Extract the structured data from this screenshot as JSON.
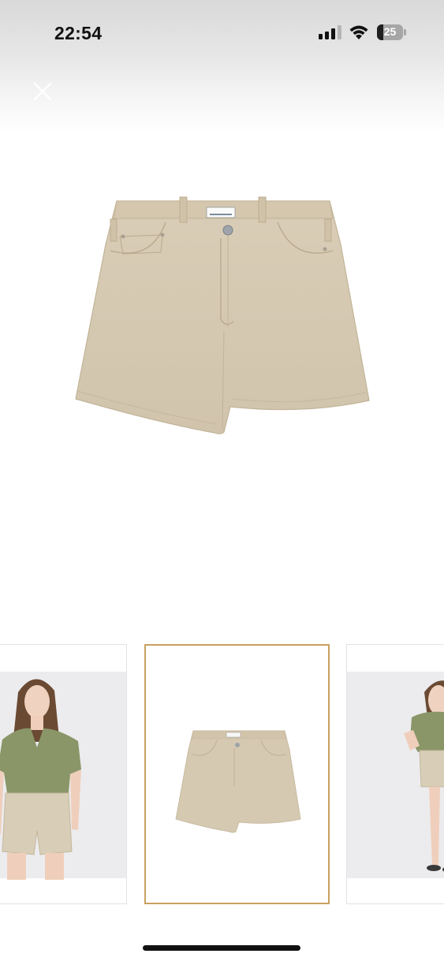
{
  "status_bar": {
    "time": "22:54",
    "battery_level": "25",
    "icons": [
      "cellular-signal-icon",
      "wifi-icon",
      "battery-icon"
    ]
  },
  "viewer": {
    "close_icon": "close-icon",
    "main_image": "beige-denim-shorts-product-photo",
    "thumbnails": [
      {
        "id": "model-front-green-tee",
        "selected": false
      },
      {
        "id": "product-flat-shorts",
        "selected": true
      },
      {
        "id": "model-side-green-tee",
        "selected": false
      }
    ]
  },
  "colors": {
    "selection_border": "#c8a060",
    "denim": "#d6c9b2"
  }
}
